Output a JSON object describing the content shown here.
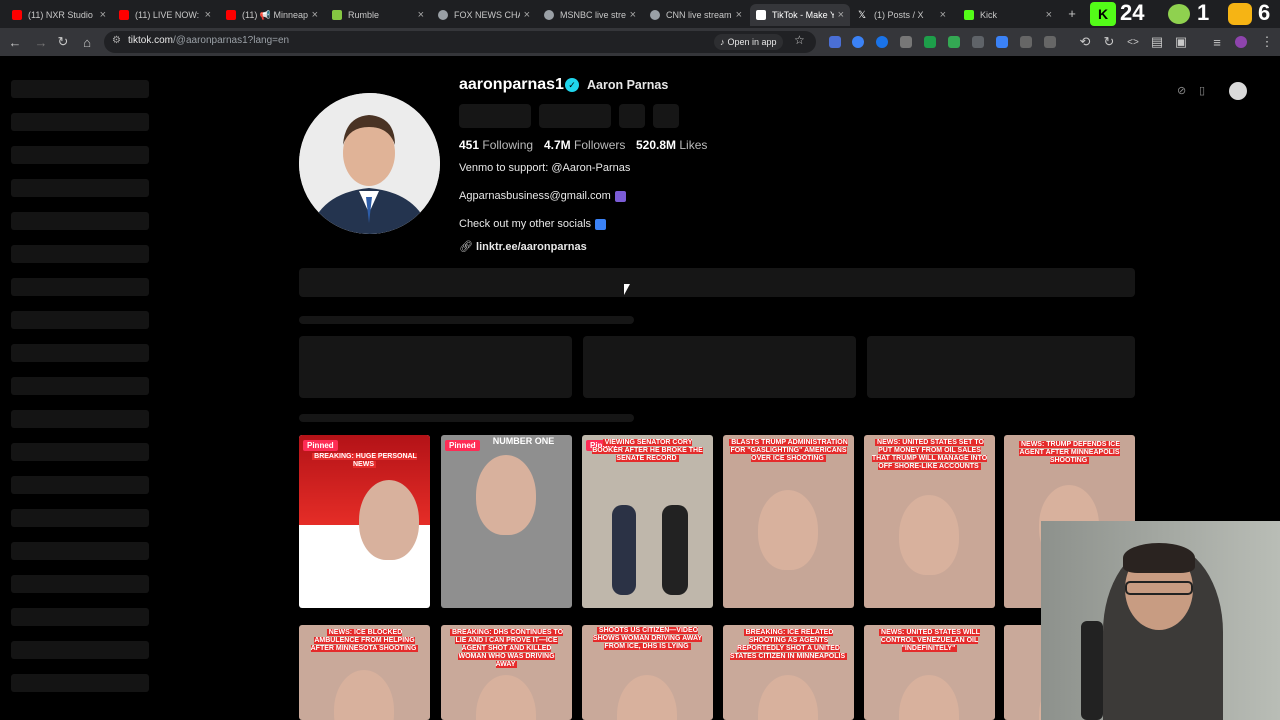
{
  "browser": {
    "tabs": [
      {
        "label": "(11) NXR Studio",
        "color": "#ff0000"
      },
      {
        "label": "(11) LIVE NOW:",
        "color": "#ff0000"
      },
      {
        "label": "(11) 📢 Minneap",
        "color": "#ff0000"
      },
      {
        "label": "Rumble",
        "color": "#85c742"
      },
      {
        "label": "FOX NEWS CHA",
        "color": "#9aa0a6"
      },
      {
        "label": "MSNBC live stre",
        "color": "#9aa0a6"
      },
      {
        "label": "CNN live stream",
        "color": "#9aa0a6"
      },
      {
        "label": "TikTok - Make Y",
        "color": "#ffffff"
      },
      {
        "label": "(1) Posts / X",
        "color": "#ffffff"
      },
      {
        "label": "Kick",
        "color": "#53fc18"
      }
    ],
    "active_tab": 7,
    "url_host": "tiktok.com",
    "url_path": "/@aaronparnas1?lang=en",
    "open_in_app": "Open in app",
    "overlay_counters": [
      "24",
      "1",
      "6"
    ]
  },
  "profile": {
    "username": "aaronparnas1",
    "display_name": "Aaron Parnas",
    "following_count": "451",
    "following_label": "Following",
    "followers_count": "4.7M",
    "followers_label": "Followers",
    "likes_count": "520.8M",
    "likes_label": "Likes",
    "bio_line1": "Venmo to support: @Aaron-Parnas",
    "bio_line2": "Agparnasbusiness@gmail.com",
    "bio_line3": "Check out my other socials",
    "link": "linktr.ee/aaronparnas"
  },
  "videos": [
    {
      "pinned": "Pinned",
      "caption": "BREAKING: HUGE PERSONAL NEWS",
      "bg": "#d43030"
    },
    {
      "pinned": "Pinned",
      "caption": "NUMBER ONE",
      "bg": "#8f8f8f"
    },
    {
      "pinned": "Pinned",
      "caption": "VIEWING SENATOR CORY BOOKER AFTER HE BROKE THE SENATE RECORD",
      "bg": "#bfb7ab"
    },
    {
      "pinned": "",
      "caption": "BLASTS TRUMP ADMINISTRATION FOR \"GASLIGHTING\" AMERICANS OVER ICE SHOOTING",
      "bg": "#c6a697"
    },
    {
      "pinned": "",
      "caption": "NEWS: UNITED STATES SET TO PUT MONEY FROM OIL SALES THAT TRUMP WILL MANAGE INTO OFF SHORE-LIKE ACCOUNTS",
      "bg": "#c9a797"
    },
    {
      "pinned": "",
      "caption": "NEWS: TRUMP DEFENDS ICE AGENT AFTER MINNEAPOLIS SHOOTING",
      "bg": "#c6a596"
    },
    {
      "pinned": "",
      "caption": "NEWS: ICE BLOCKED AMBULENCE FROM HELPING AFTER MINNESOTA SHOOTING",
      "bg": "#c9a99a"
    },
    {
      "pinned": "",
      "caption": "BREAKING: DHS CONTINUES TO LIE AND I CAN PROVE IT—ICE AGENT SHOT AND KILLED WOMAN WHO WAS DRIVING AWAY",
      "bg": "#c9a99a"
    },
    {
      "pinned": "",
      "caption": "SHOOTS US CITIZEN—VIDEO SHOWS WOMAN DRIVING AWAY FROM ICE, DHS IS LYING",
      "bg": "#c9a99a"
    },
    {
      "pinned": "",
      "caption": "BREAKING: ICE RELATED SHOOTING AS AGENTS REPORTEDLY SHOT A UNITED STATES CITIZEN IN MINNEAPOLIS",
      "bg": "#c9a99a"
    },
    {
      "pinned": "",
      "caption": "NEWS: UNITED STATES WILL CONTROL VENEZUELAN OIL \"INDEFINITELY\"",
      "bg": "#c9a99a"
    },
    {
      "pinned": "",
      "caption": "",
      "bg": "#c9a99a"
    }
  ]
}
